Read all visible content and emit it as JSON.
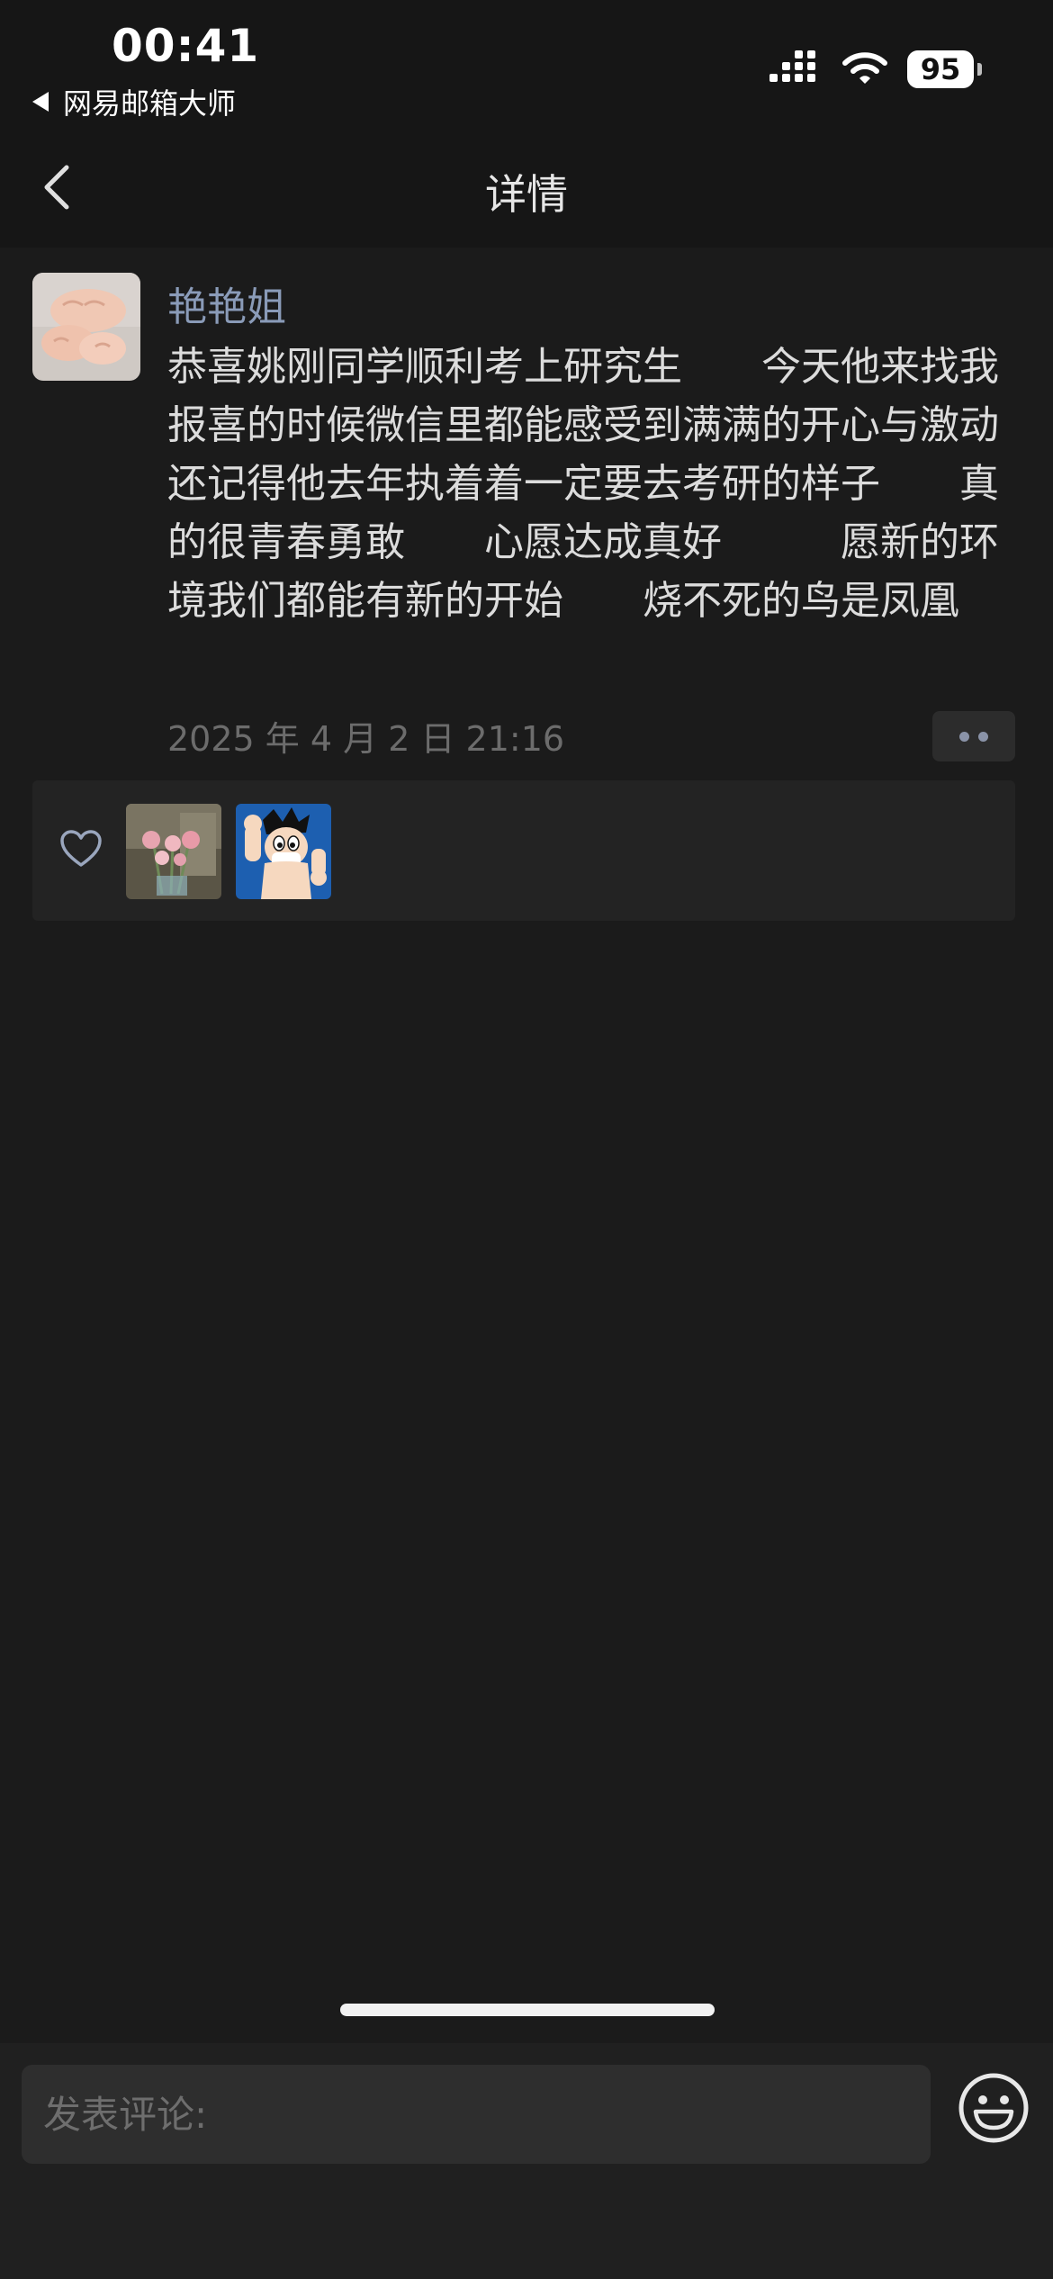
{
  "status_bar": {
    "time": "00:41",
    "back_app_label": "网易邮箱大师",
    "battery": "95"
  },
  "nav": {
    "title": "详情"
  },
  "post": {
    "author": "艳艳姐",
    "text": "恭喜姚刚同学顺利考上研究生　　今天他来找我报喜的时候微信里都能感受到满满的开心与激动　　还记得他去年执着着一定要去考研的样子　　真的很青春勇敢　　心愿达成真好　　　愿新的环境我们都能有新的开始　　烧不死的鸟是凤凰",
    "timestamp": "2025 年 4 月 2 日 21:16",
    "more_icon": "ellipsis-icon"
  },
  "likes": {
    "icon": "heart-icon",
    "likers": [
      "flowers-avatar",
      "astro-boy-avatar"
    ]
  },
  "comment": {
    "placeholder": "发表评论:",
    "emoji_icon": "smiley-icon"
  },
  "colors": {
    "background": "#191919",
    "author_name": "#8a9bb8",
    "secondary_text": "#6c6c6c"
  }
}
